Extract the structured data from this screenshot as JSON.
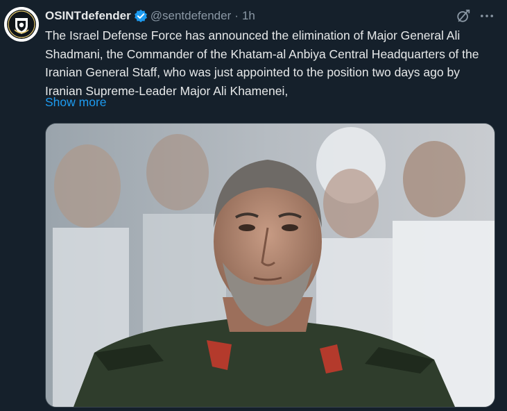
{
  "author": {
    "display_name": "OSINTdefender",
    "handle": "@sentdefender",
    "separator": "·",
    "time": "1h",
    "verified_color": "#1d9bf0",
    "avatar_icon": "osint-shield-logo"
  },
  "post": {
    "text": "The Israel Defense Force has announced the elimination of Major General Ali Shadmani, the Commander of the Khatam-al Anbiya Central Headquarters of the Iranian General Staff, who was just appointed to the position two days ago by Iranian Supreme-Leader Major Ali Khamenei,",
    "show_more_label": "Show more"
  },
  "actions": {
    "grok_icon": "grok-icon",
    "more_icon": "more-options-icon"
  },
  "media": {
    "description_icon": "photo"
  },
  "colors": {
    "background": "#15202b",
    "text": "#e7e9ea",
    "secondary": "#8b98a5",
    "link": "#1d9bf0"
  }
}
